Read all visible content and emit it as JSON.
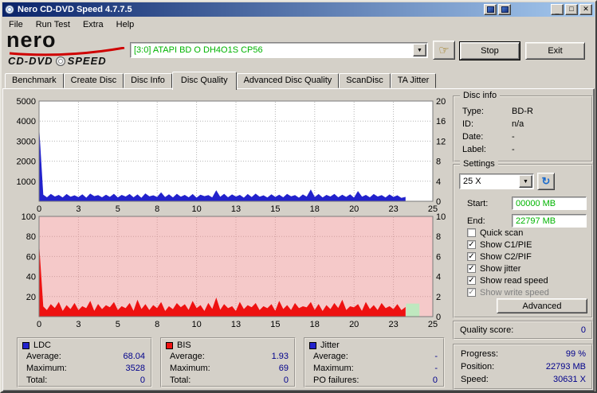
{
  "window": {
    "title": "Nero CD-DVD Speed 4.7.7.5"
  },
  "icons": {
    "minimize": "_",
    "maximize": "□",
    "close": "✕",
    "dropdown": "▼",
    "refresh": "↻",
    "hand": "☞"
  },
  "menu": {
    "items": [
      "File",
      "Run Test",
      "Extra",
      "Help"
    ]
  },
  "header": {
    "brand_name": "nero",
    "brand_cd": "CD-DVD",
    "brand_speed": "SPEED",
    "drive": "[3:0]  ATAPI BD  O  DH4O1S CP56",
    "stop": "Stop",
    "exit": "Exit"
  },
  "tabs": {
    "items": [
      "Benchmark",
      "Create Disc",
      "Disc Info",
      "Disc Quality",
      "Advanced Disc Quality",
      "ScanDisc",
      "TA Jitter"
    ],
    "active": "Disc Quality"
  },
  "colors": {
    "value_text": "#00008b",
    "drive_text": "#00b400",
    "ldc_series": "#2222cc",
    "bis_series": "#ee1111",
    "bis_background": "#f5c9c9"
  },
  "disc_info": {
    "title": "Disc info",
    "rows": [
      {
        "label": "Type:",
        "value": "BD-R"
      },
      {
        "label": "ID:",
        "value": "n/a"
      },
      {
        "label": "Date:",
        "value": "-"
      },
      {
        "label": "Label:",
        "value": "-"
      }
    ]
  },
  "settings": {
    "title": "Settings",
    "speed": "25 X",
    "start_label": "Start:",
    "start_value": "00000 MB",
    "end_label": "End:",
    "end_value": "22797 MB",
    "checkboxes": [
      {
        "label": "Quick scan",
        "checked": false,
        "mark": ""
      },
      {
        "label": "Show C1/PIE",
        "checked": true,
        "mark": "✓"
      },
      {
        "label": "Show C2/PIF",
        "checked": true,
        "mark": "✓"
      },
      {
        "label": "Show jitter",
        "checked": true,
        "mark": "✓"
      },
      {
        "label": "Show read speed",
        "checked": true,
        "mark": "✓"
      },
      {
        "label": "Show write speed",
        "checked": true,
        "disabled": true,
        "mark": "✓"
      }
    ],
    "advanced": "Advanced"
  },
  "quality": {
    "label": "Quality score:",
    "value": "0"
  },
  "progress": {
    "rows": [
      {
        "label": "Progress:",
        "value": "99 %"
      },
      {
        "label": "Position:",
        "value": "22793 MB"
      },
      {
        "label": "Speed:",
        "value": "30631 X"
      }
    ]
  },
  "stats": {
    "boxes": [
      {
        "name": "LDC",
        "color": "#2222cc",
        "rows": [
          [
            "Average:",
            "68.04"
          ],
          [
            "Maximum:",
            "3528"
          ],
          [
            "Total:",
            "0"
          ]
        ]
      },
      {
        "name": "BIS",
        "color": "#ee1111",
        "rows": [
          [
            "Average:",
            "1.93"
          ],
          [
            "Maximum:",
            "69"
          ],
          [
            "Total:",
            "0"
          ]
        ]
      },
      {
        "name": "Jitter",
        "color": "#2222cc",
        "rows": [
          [
            "Average:",
            "-"
          ],
          [
            "Maximum:",
            "-"
          ],
          [
            "PO failures:",
            "0"
          ]
        ]
      }
    ]
  },
  "chart_data": [
    {
      "type": "area",
      "name": "LDC errors vs read speed",
      "x_step": 0.25,
      "xlim": [
        0,
        25
      ],
      "ylim": [
        0,
        5000
      ],
      "bg": "#ffffff",
      "grid": "#b4b4b4",
      "grid_y": [
        1000,
        2000,
        3000,
        4000
      ],
      "y_left": [
        {
          "v": 5000,
          "t": "5000"
        },
        {
          "v": 4000,
          "t": "4000"
        },
        {
          "v": 3000,
          "t": "3000"
        },
        {
          "v": 2000,
          "t": "2000"
        },
        {
          "v": 1000,
          "t": "1000"
        }
      ],
      "y_right": [
        {
          "v": 5000,
          "t": "20"
        },
        {
          "v": 4000,
          "t": "16"
        },
        {
          "v": 3000,
          "t": "12"
        },
        {
          "v": 2000,
          "t": "8"
        },
        {
          "v": 1000,
          "t": "4"
        },
        {
          "v": 0,
          "t": "0"
        }
      ],
      "x_ticks": [
        {
          "pos": 0,
          "label": "0"
        },
        {
          "pos": 2.5,
          "label": "3"
        },
        {
          "pos": 5,
          "label": "5"
        },
        {
          "pos": 7.5,
          "label": "8"
        },
        {
          "pos": 10,
          "label": "10"
        },
        {
          "pos": 12.5,
          "label": "13"
        },
        {
          "pos": 15,
          "label": "15"
        },
        {
          "pos": 17.5,
          "label": "18"
        },
        {
          "pos": 20,
          "label": "20"
        },
        {
          "pos": 22.5,
          "label": "23"
        },
        {
          "pos": 25,
          "label": "25"
        }
      ],
      "series": [
        {
          "name": "LDC",
          "color": "#2222cc",
          "values": [
            3528,
            320,
            180,
            350,
            220,
            300,
            170,
            340,
            210,
            280,
            190,
            330,
            160,
            360,
            240,
            290,
            180,
            310,
            200,
            350,
            170,
            300,
            220,
            340,
            180,
            320,
            150,
            370,
            230,
            280,
            200,
            420,
            190,
            330,
            170,
            350,
            210,
            300,
            180,
            340,
            160,
            310,
            240,
            290,
            170,
            520,
            200,
            350,
            180,
            320,
            220,
            300,
            160,
            340,
            190,
            360,
            210,
            280,
            170,
            330,
            200,
            310,
            180,
            350,
            230,
            290,
            160,
            320,
            210,
            560,
            190,
            340,
            170,
            300,
            220,
            350,
            180,
            310,
            200,
            330,
            160,
            480,
            210,
            300,
            180,
            340,
            220,
            290,
            170,
            320,
            200,
            280,
            150,
            200
          ]
        }
      ]
    },
    {
      "type": "area",
      "name": "BIS errors",
      "x_step": 0.25,
      "xlim": [
        0,
        25
      ],
      "ylim": [
        0,
        100
      ],
      "bg": "#f5c9c9",
      "grid": "#cf9f9f",
      "grid_y": [
        20,
        40,
        60,
        80
      ],
      "y_left": [
        {
          "v": 100,
          "t": "100"
        },
        {
          "v": 80,
          "t": "80"
        },
        {
          "v": 60,
          "t": "60"
        },
        {
          "v": 40,
          "t": "40"
        },
        {
          "v": 20,
          "t": "20"
        }
      ],
      "y_right": [
        {
          "v": 100,
          "t": "10"
        },
        {
          "v": 80,
          "t": "8"
        },
        {
          "v": 60,
          "t": "6"
        },
        {
          "v": 40,
          "t": "4"
        },
        {
          "v": 20,
          "t": "2"
        },
        {
          "v": 0,
          "t": "0"
        }
      ],
      "x_ticks": [
        {
          "pos": 0,
          "label": "0"
        },
        {
          "pos": 2.5,
          "label": "3"
        },
        {
          "pos": 5,
          "label": "5"
        },
        {
          "pos": 7.5,
          "label": "8"
        },
        {
          "pos": 10,
          "label": "10"
        },
        {
          "pos": 12.5,
          "label": "13"
        },
        {
          "pos": 15,
          "label": "15"
        },
        {
          "pos": 17.5,
          "label": "18"
        },
        {
          "pos": 20,
          "label": "20"
        },
        {
          "pos": 22.5,
          "label": "23"
        },
        {
          "pos": 25,
          "label": "25"
        }
      ],
      "end_region": {
        "x0": 23.3,
        "x1": 24.15,
        "y": 13,
        "color": "#bfe8bf"
      },
      "series": [
        {
          "name": "BIS",
          "color": "#ee1111",
          "values": [
            69,
            10,
            6,
            12,
            8,
            14,
            5,
            11,
            7,
            13,
            6,
            10,
            8,
            15,
            5,
            12,
            7,
            11,
            9,
            14,
            6,
            10,
            8,
            13,
            5,
            16,
            7,
            12,
            6,
            11,
            8,
            14,
            5,
            10,
            7,
            13,
            9,
            12,
            6,
            15,
            8,
            11,
            5,
            13,
            7,
            18,
            6,
            12,
            8,
            10,
            5,
            14,
            7,
            11,
            9,
            13,
            6,
            10,
            8,
            12,
            5,
            15,
            7,
            11,
            6,
            13,
            8,
            10,
            9,
            14,
            6,
            12,
            5,
            11,
            7,
            13,
            8,
            16,
            6,
            10,
            9,
            12,
            5,
            14,
            7,
            11,
            6,
            13,
            8,
            10,
            7,
            12,
            6,
            9
          ]
        }
      ]
    }
  ]
}
